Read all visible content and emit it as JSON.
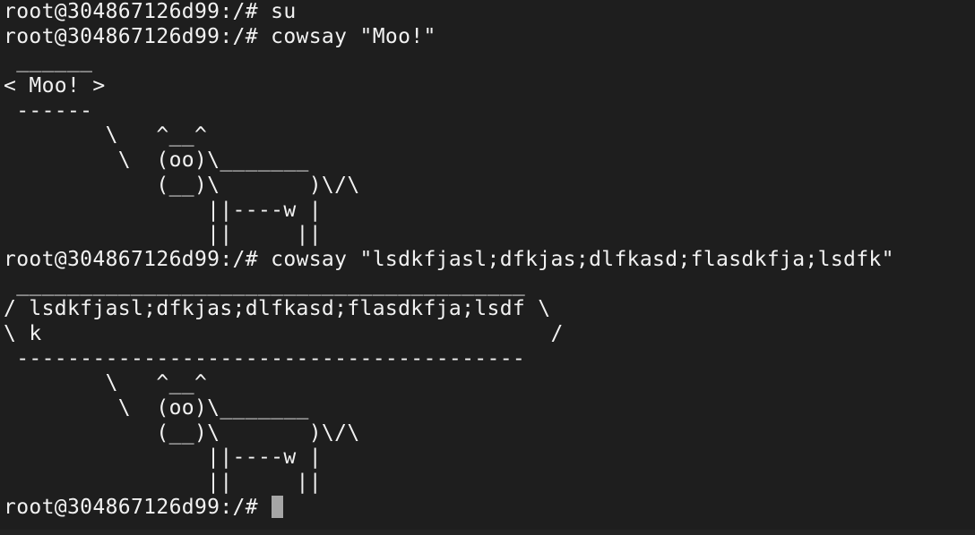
{
  "terminal": {
    "lines": [
      "root@304867126d99:/# su",
      "root@304867126d99:/# cowsay \"Moo!\"",
      " ______",
      "< Moo! >",
      " ------",
      "        \\   ^__^",
      "         \\  (oo)\\_______",
      "            (__)\\       )\\/\\",
      "                ||----w |",
      "                ||     ||",
      "root@304867126d99:/# cowsay \"lsdkfjasl;dfkjas;dlfkasd;flasdkfja;lsdfk\"",
      " ________________________________________",
      "/ lsdkfjasl;dfkjas;dlfkasd;flasdkfja;lsdf \\",
      "\\ k                                        /",
      " ----------------------------------------",
      "        \\   ^__^",
      "         \\  (oo)\\_______",
      "            (__)\\       )\\/\\",
      "                ||----w |",
      "                ||     ||"
    ],
    "current_prompt": "root@304867126d99:/# "
  }
}
